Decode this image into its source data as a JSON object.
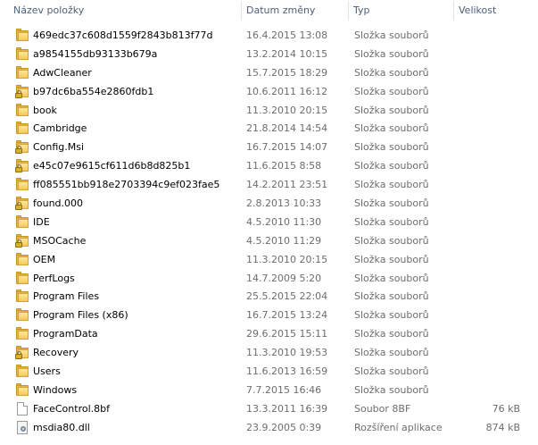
{
  "columns": {
    "name": "Název položky",
    "date": "Datum změny",
    "type": "Typ",
    "size": "Velikost"
  },
  "rows": [
    {
      "name": "469edc37c608d1559f2843b813f77d",
      "date": "16.4.2015 13:08",
      "type": "Složka souborů",
      "size": "",
      "icon": "folder-icon"
    },
    {
      "name": "a9854155db93133b679a",
      "date": "13.2.2014 10:15",
      "type": "Složka souborů",
      "size": "",
      "icon": "folder-icon"
    },
    {
      "name": "AdwCleaner",
      "date": "15.7.2015 18:29",
      "type": "Složka souborů",
      "size": "",
      "icon": "folder-icon"
    },
    {
      "name": "b97dc6ba554e2860fdb1",
      "date": "10.6.2011 16:12",
      "type": "Složka souborů",
      "size": "",
      "icon": "locked-folder-icon"
    },
    {
      "name": "book",
      "date": "11.3.2010 20:15",
      "type": "Složka souborů",
      "size": "",
      "icon": "folder-icon"
    },
    {
      "name": "Cambridge",
      "date": "21.8.2014 14:54",
      "type": "Složka souborů",
      "size": "",
      "icon": "folder-icon"
    },
    {
      "name": "Config.Msi",
      "date": "16.7.2015 14:07",
      "type": "Složka souborů",
      "size": "",
      "icon": "locked-folder-icon"
    },
    {
      "name": "e45c07e9615cf611d6b8d825b1",
      "date": "11.6.2015 8:58",
      "type": "Složka souborů",
      "size": "",
      "icon": "locked-folder-icon"
    },
    {
      "name": "ff085551bb918e2703394c9ef023fae5",
      "date": "14.2.2011 23:51",
      "type": "Složka souborů",
      "size": "",
      "icon": "folder-icon"
    },
    {
      "name": "found.000",
      "date": "2.8.2013 10:33",
      "type": "Složka souborů",
      "size": "",
      "icon": "locked-folder-icon"
    },
    {
      "name": "IDE",
      "date": "4.5.2010 11:30",
      "type": "Složka souborů",
      "size": "",
      "icon": "folder-icon"
    },
    {
      "name": "MSOCache",
      "date": "4.5.2010 11:29",
      "type": "Složka souborů",
      "size": "",
      "icon": "locked-folder-icon"
    },
    {
      "name": "OEM",
      "date": "11.3.2010 20:15",
      "type": "Složka souborů",
      "size": "",
      "icon": "folder-icon"
    },
    {
      "name": "PerfLogs",
      "date": "14.7.2009 5:20",
      "type": "Složka souborů",
      "size": "",
      "icon": "folder-icon"
    },
    {
      "name": "Program Files",
      "date": "25.5.2015 22:04",
      "type": "Složka souborů",
      "size": "",
      "icon": "folder-icon"
    },
    {
      "name": "Program Files (x86)",
      "date": "16.7.2015 13:24",
      "type": "Složka souborů",
      "size": "",
      "icon": "folder-icon"
    },
    {
      "name": "ProgramData",
      "date": "29.6.2015 15:11",
      "type": "Složka souborů",
      "size": "",
      "icon": "folder-icon"
    },
    {
      "name": "Recovery",
      "date": "11.3.2010 19:53",
      "type": "Složka souborů",
      "size": "",
      "icon": "locked-folder-icon"
    },
    {
      "name": "Users",
      "date": "11.6.2013 16:59",
      "type": "Složka souborů",
      "size": "",
      "icon": "folder-icon"
    },
    {
      "name": "Windows",
      "date": "7.7.2015 16:46",
      "type": "Složka souborů",
      "size": "",
      "icon": "folder-icon"
    },
    {
      "name": "FaceControl.8bf",
      "date": "13.3.2011 16:39",
      "type": "Soubor 8BF",
      "size": "76 kB",
      "icon": "file-icon"
    },
    {
      "name": "msdia80.dll",
      "date": "23.9.2005 0:39",
      "type": "Rozšíření aplikace",
      "size": "874 kB",
      "icon": "dll-file-icon"
    }
  ]
}
